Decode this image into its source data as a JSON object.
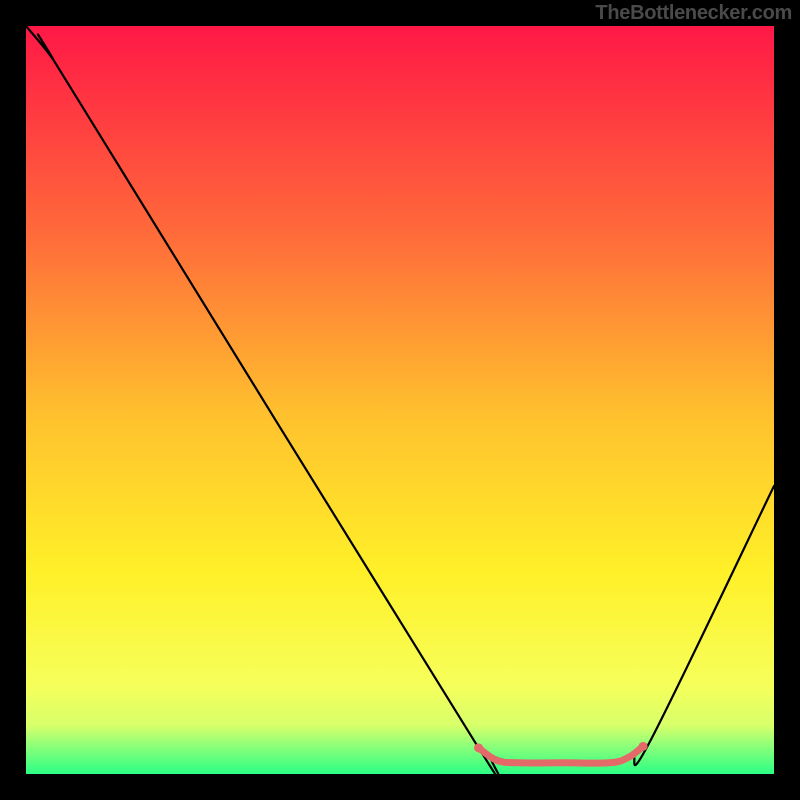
{
  "attribution": "TheBottlenecker.com",
  "chart_data": {
    "type": "line",
    "title": "",
    "xlabel": "",
    "ylabel": "",
    "xlim": [
      0,
      100
    ],
    "ylim": [
      0,
      100
    ],
    "gradient_stops": [
      {
        "offset": 0,
        "color": "#ff1846"
      },
      {
        "offset": 0.28,
        "color": "#ff6b3a"
      },
      {
        "offset": 0.52,
        "color": "#ffc12e"
      },
      {
        "offset": 0.73,
        "color": "#fff028"
      },
      {
        "offset": 0.88,
        "color": "#f6ff5a"
      },
      {
        "offset": 0.935,
        "color": "#d8ff6a"
      },
      {
        "offset": 0.965,
        "color": "#86ff7a"
      },
      {
        "offset": 1.0,
        "color": "#2bff84"
      }
    ],
    "note": "x/y are percentages of plot width/height; y=0 top, y=100 bottom",
    "series": [
      {
        "name": "curve",
        "color": "#000000",
        "width": 2.2,
        "points": [
          {
            "x": 0,
            "y": 0
          },
          {
            "x": 3.5,
            "y": 4.3
          },
          {
            "x": 6.8,
            "y": 9.6
          },
          {
            "x": 60.0,
            "y": 95.7
          },
          {
            "x": 62.0,
            "y": 97.4
          },
          {
            "x": 65.0,
            "y": 98.3
          },
          {
            "x": 70.0,
            "y": 98.3
          },
          {
            "x": 78.0,
            "y": 98.3
          },
          {
            "x": 81.0,
            "y": 97.4
          },
          {
            "x": 83.5,
            "y": 95.5
          },
          {
            "x": 100,
            "y": 61.5
          }
        ]
      },
      {
        "name": "highlight",
        "color": "#e46a6a",
        "width": 7,
        "points": [
          {
            "x": 60.5,
            "y": 96.5
          },
          {
            "x": 63.0,
            "y": 98.2
          },
          {
            "x": 66.0,
            "y": 98.5
          },
          {
            "x": 72.0,
            "y": 98.5
          },
          {
            "x": 78.0,
            "y": 98.5
          },
          {
            "x": 80.5,
            "y": 97.8
          },
          {
            "x": 82.5,
            "y": 96.3
          }
        ],
        "dot_radius": 4.5,
        "end_dots": true
      }
    ]
  }
}
